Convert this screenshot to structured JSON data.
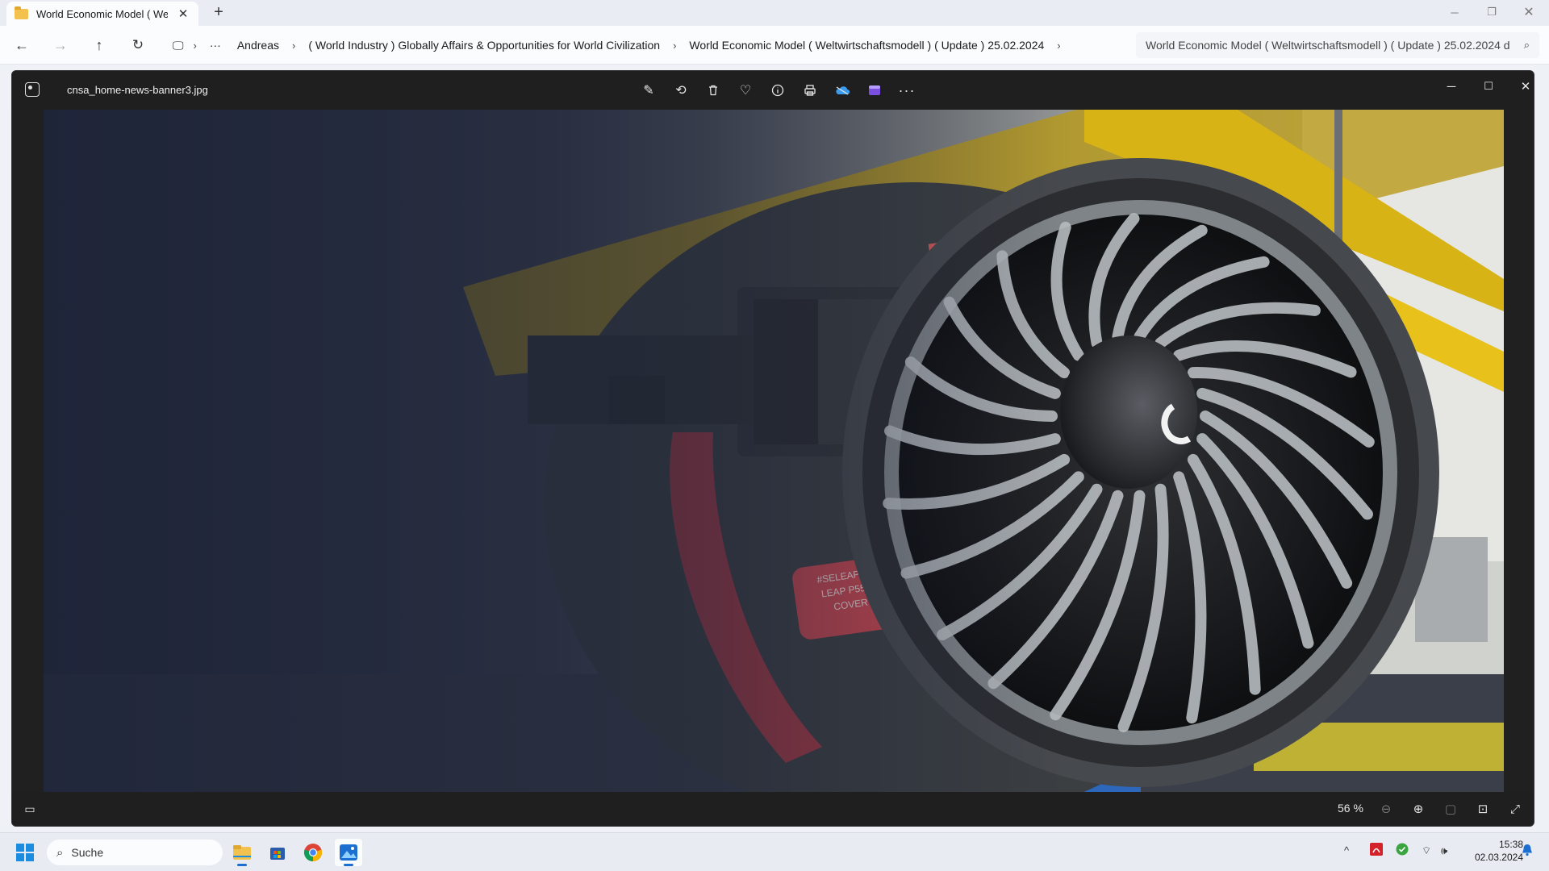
{
  "explorer": {
    "tab_title": "World Economic Model ( Welt",
    "breadcrumbs": [
      "Andreas",
      "( World Industry ) Globally Affairs & Opportunities for World Civilization",
      "World Economic Model ( Weltwirtschaftsmodell ) ( Update ) 25.02.2024"
    ],
    "search_placeholder": "World Economic Model ( Weltwirtschaftsmodell ) ( Update ) 25.02.2024 d"
  },
  "viewer": {
    "filename": "cnsa_home-news-banner3.jpg",
    "zoom": "56 %",
    "toolbar_icons": [
      "edit-icon",
      "rotate-icon",
      "delete-icon",
      "favorite-icon",
      "info-icon",
      "print-icon",
      "onedrive-icon",
      "clipchamp-icon",
      "more-icon"
    ]
  },
  "taskbar": {
    "search_label": "Suche",
    "time": "15:38",
    "date": "02.03.2024"
  },
  "colors": {
    "accent": "#1b6fd0",
    "engine_red": "#c9474f",
    "hangar_yellow": "#e8c21a"
  }
}
